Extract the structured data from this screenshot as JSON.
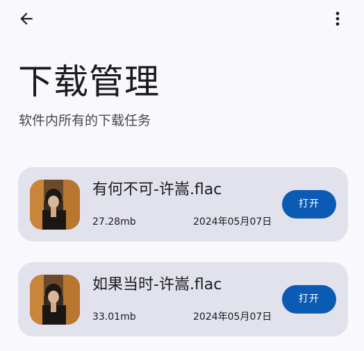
{
  "header": {
    "back_icon": "arrow-back-icon",
    "menu_icon": "more-vert-icon"
  },
  "page": {
    "title": "下载管理",
    "subtitle": "软件内所有的下载任务"
  },
  "downloads": [
    {
      "name": "有何不可-许嵩.flac",
      "size": "27.28mb",
      "date": "2024年05月07日",
      "action_label": "打开"
    },
    {
      "name": "如果当时-许嵩.flac",
      "size": "33.01mb",
      "date": "2024年05月07日",
      "action_label": "打开"
    }
  ],
  "colors": {
    "background": "#f9f8fd",
    "card": "#e1e2ec",
    "accent": "#0b5bb5"
  }
}
